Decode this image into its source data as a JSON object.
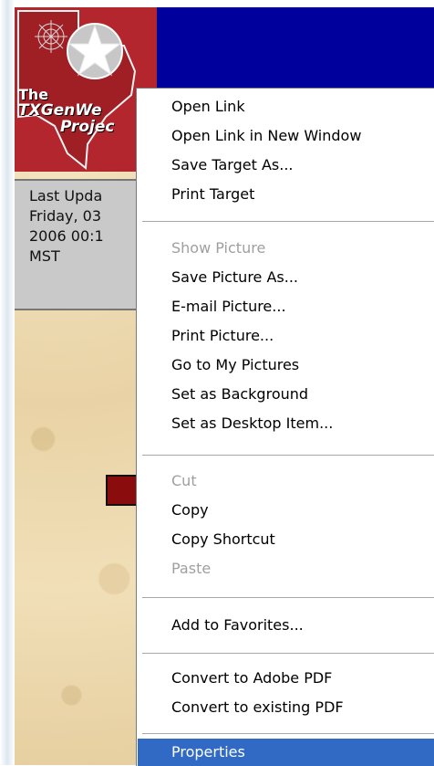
{
  "logo": {
    "line1": "The",
    "line2": "TXGenWe",
    "line3": "Projec"
  },
  "last_update": {
    "text": "Last Upda\nFriday, 03\n2006 00:1\nMST"
  },
  "context_menu": {
    "items": [
      {
        "label": "Open Link",
        "enabled": true
      },
      {
        "label": "Open Link in New Window",
        "enabled": true
      },
      {
        "label": "Save Target As...",
        "enabled": true
      },
      {
        "label": "Print Target",
        "enabled": true
      },
      {
        "label": "Show Picture",
        "enabled": false
      },
      {
        "label": "Save Picture As...",
        "enabled": true
      },
      {
        "label": "E-mail Picture...",
        "enabled": true
      },
      {
        "label": "Print Picture...",
        "enabled": true
      },
      {
        "label": "Go to My Pictures",
        "enabled": true
      },
      {
        "label": "Set as Background",
        "enabled": true
      },
      {
        "label": "Set as Desktop Item...",
        "enabled": true
      },
      {
        "label": "Cut",
        "enabled": false
      },
      {
        "label": "Copy",
        "enabled": true
      },
      {
        "label": "Copy Shortcut",
        "enabled": true
      },
      {
        "label": "Paste",
        "enabled": false
      },
      {
        "label": "Add to Favorites...",
        "enabled": true
      },
      {
        "label": "Convert to Adobe PDF",
        "enabled": true
      },
      {
        "label": "Convert to existing PDF",
        "enabled": true
      },
      {
        "label": "Properties",
        "enabled": true,
        "highlighted": true
      }
    ]
  },
  "colors": {
    "header_blue": "#00009c",
    "logo_red": "#b3262d",
    "menu_highlight": "#316ac5",
    "disabled_text": "#9f9f9f",
    "button_red": "#8b0c0c"
  },
  "icons": [
    "texas-star-icon",
    "web-spider-icon"
  ]
}
